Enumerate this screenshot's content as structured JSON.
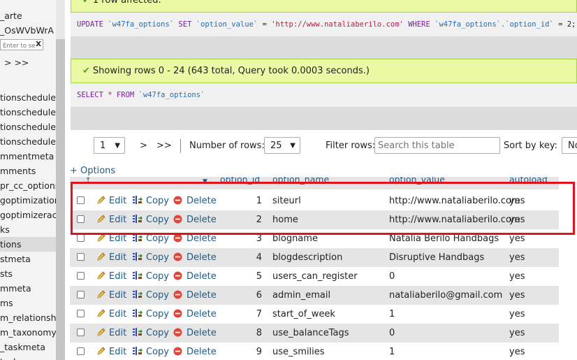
{
  "sidebar": {
    "db_lines": [
      "_arte",
      "_OsWVbWrA"
    ],
    "filter_placeholder": "Enter to se",
    "filter_clear": "X",
    "pager": "> >>",
    "items": [
      {
        "label": "tionscheduler",
        "active": false
      },
      {
        "label": "tionscheduler",
        "active": false
      },
      {
        "label": "tionscheduler",
        "active": false
      },
      {
        "label": "tionscheduler",
        "active": false
      },
      {
        "label": "mmentmeta",
        "active": false
      },
      {
        "label": "mments",
        "active": false
      },
      {
        "label": "pr_cc_options",
        "active": false
      },
      {
        "label": "goptimization",
        "active": false
      },
      {
        "label": "goptimizeract",
        "active": false
      },
      {
        "label": "ks",
        "active": false
      },
      {
        "label": "tions",
        "active": true
      },
      {
        "label": "stmeta",
        "active": false
      },
      {
        "label": "sts",
        "active": false
      },
      {
        "label": "mmeta",
        "active": false
      },
      {
        "label": "ms",
        "active": false
      },
      {
        "label": "m_relationshi",
        "active": false
      },
      {
        "label": "m_taxonomy",
        "active": false
      },
      {
        "label": "_taskmeta",
        "active": false
      },
      {
        "label": "tasks",
        "active": false
      }
    ]
  },
  "update_result": {
    "message": "1 row affected.",
    "sql": {
      "kw1": "UPDATE",
      "table": "`w47fa_options`",
      "kw2": "SET",
      "col": "`option_value`",
      "eq": "=",
      "value": "'http://www.nataliaberilo.com'",
      "kw3": "WHERE",
      "where_col": "`w47fa_options`.`option_id`",
      "eq2": "=",
      "where_val": "2;"
    }
  },
  "select_result": {
    "message": "Showing rows 0 - 24 (643 total, Query took 0.0003 seconds.)",
    "sql": {
      "kw1": "SELECT",
      "star": "*",
      "kw2": "FROM",
      "table": "`w47fa_options`"
    }
  },
  "pager": {
    "page": "1",
    "next": ">",
    "last": ">>",
    "rows_label": "Number of rows:",
    "rows_value": "25",
    "filter_label": "Filter rows:",
    "filter_placeholder": "Search this table",
    "sort_label": "Sort by key:",
    "sort_value": "No"
  },
  "options_link": "+ Options",
  "table": {
    "headers": [
      "option_id",
      "option_name",
      "option_value",
      "autoload"
    ],
    "actions": {
      "edit": "Edit",
      "copy": "Copy",
      "delete": "Delete"
    },
    "rows": [
      {
        "id": "1",
        "name": "siteurl",
        "value": "http://www.nataliaberilo.com",
        "autoload": "yes"
      },
      {
        "id": "2",
        "name": "home",
        "value": "http://www.nataliaberilo.com",
        "autoload": "yes"
      },
      {
        "id": "3",
        "name": "blogname",
        "value": "Natalia Berilo Handbags",
        "autoload": "yes"
      },
      {
        "id": "4",
        "name": "blogdescription",
        "value": "Disruptive Handbags",
        "autoload": "yes"
      },
      {
        "id": "5",
        "name": "users_can_register",
        "value": "0",
        "autoload": "yes"
      },
      {
        "id": "6",
        "name": "admin_email",
        "value": "nataliaberilo@gmail.com",
        "autoload": "yes"
      },
      {
        "id": "7",
        "name": "start_of_week",
        "value": "1",
        "autoload": "yes"
      },
      {
        "id": "8",
        "name": "use_balanceTags",
        "value": "0",
        "autoload": "yes"
      },
      {
        "id": "9",
        "name": "use_smilies",
        "value": "1",
        "autoload": "yes"
      }
    ]
  },
  "colors": {
    "success_bg": "#ebf8a4",
    "link": "#235a81",
    "highlight_box": "#e0141e"
  }
}
